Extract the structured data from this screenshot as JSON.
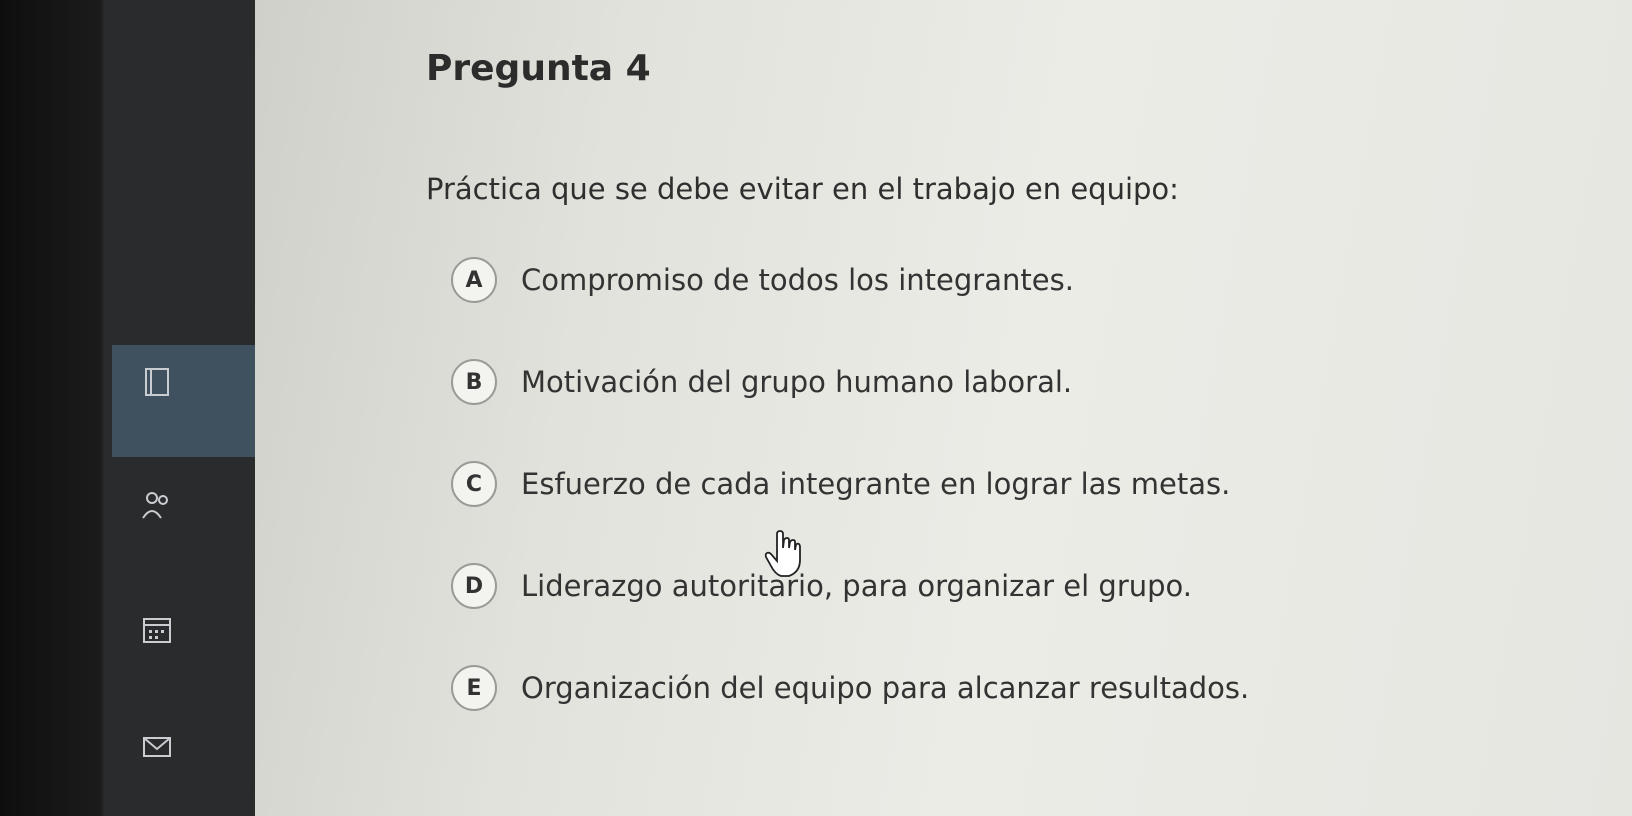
{
  "question": {
    "title": "Pregunta 4",
    "prompt": "Práctica que se debe evitar en el trabajo en equipo:"
  },
  "options": [
    {
      "letter": "A",
      "text": "Compromiso de todos los integrantes."
    },
    {
      "letter": "B",
      "text": "Motivación del grupo humano laboral."
    },
    {
      "letter": "C",
      "text": "Esfuerzo de cada integrante en lograr las metas."
    },
    {
      "letter": "D",
      "text": "Liderazgo autoritario, para organizar el grupo."
    },
    {
      "letter": "E",
      "text": "Organización del equipo para alcanzar resultados."
    }
  ],
  "sidebar": {
    "icons": [
      "bookmark-icon",
      "people-icon",
      "calendar-icon",
      "mail-icon"
    ]
  },
  "colors": {
    "sidebar_active": "#3f505e",
    "content_bg": "#e6e6e1"
  }
}
